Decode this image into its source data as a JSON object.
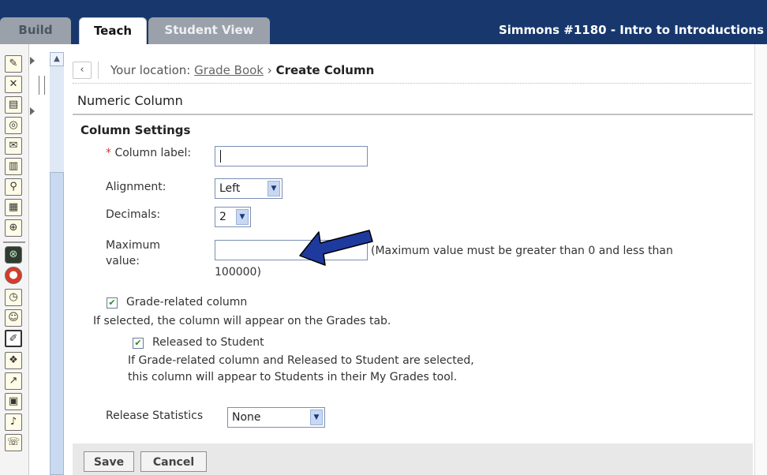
{
  "tabs": [
    {
      "label": "Build"
    },
    {
      "label": "Teach"
    },
    {
      "label": "Student View"
    }
  ],
  "course_title": "Simmons #1180 - Intro to Introductions",
  "breadcrumb": {
    "prefix": "Your location:",
    "link": "Grade Book",
    "separator": "›",
    "current": "Create Column"
  },
  "page_title": "Numeric Column",
  "section_title": "Column Settings",
  "form": {
    "column_label": {
      "required_mark": "*",
      "label": "Column label:",
      "value": ""
    },
    "alignment": {
      "label": "Alignment:",
      "value": "Left"
    },
    "decimals": {
      "label": "Decimals:",
      "value": "2"
    },
    "maximum_value": {
      "label_line1": "Maximum",
      "label_line2": "value:",
      "value": "",
      "hint_line1": "(Maximum value must be greater than 0 and less than",
      "hint_line2": "100000)"
    },
    "grade_related": {
      "label": "Grade-related column",
      "checked": true,
      "help": "If selected, the column will appear on the Grades tab."
    },
    "released_to_student": {
      "label": "Released to Student",
      "checked": true,
      "help_line1": "If Grade-related column and Released to Student are selected,",
      "help_line2": "this column will appear to Students in their My Grades tool."
    },
    "release_statistics": {
      "label": "Release Statistics",
      "value": "None"
    }
  },
  "buttons": {
    "save": "Save",
    "cancel": "Cancel"
  },
  "icons": {
    "back": "‹",
    "dropdown": "▼",
    "scroll_up": "▲",
    "check": "✔"
  },
  "colors": {
    "topbar": "#18386d",
    "annotation_arrow": "#1f3a9e",
    "required": "#d03a2a"
  }
}
